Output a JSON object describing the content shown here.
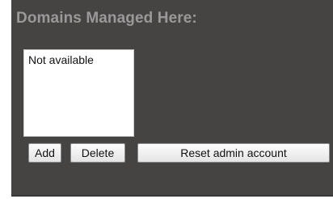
{
  "panel": {
    "title": "Domains Managed Here:"
  },
  "domains_list": {
    "items": [
      "Not available"
    ]
  },
  "buttons": {
    "add_label": "Add",
    "delete_label": "Delete",
    "reset_label": "Reset admin account"
  },
  "colors": {
    "panel_background": "#464343",
    "title_text": "#9a9898",
    "listbox_background": "#ffffff"
  }
}
